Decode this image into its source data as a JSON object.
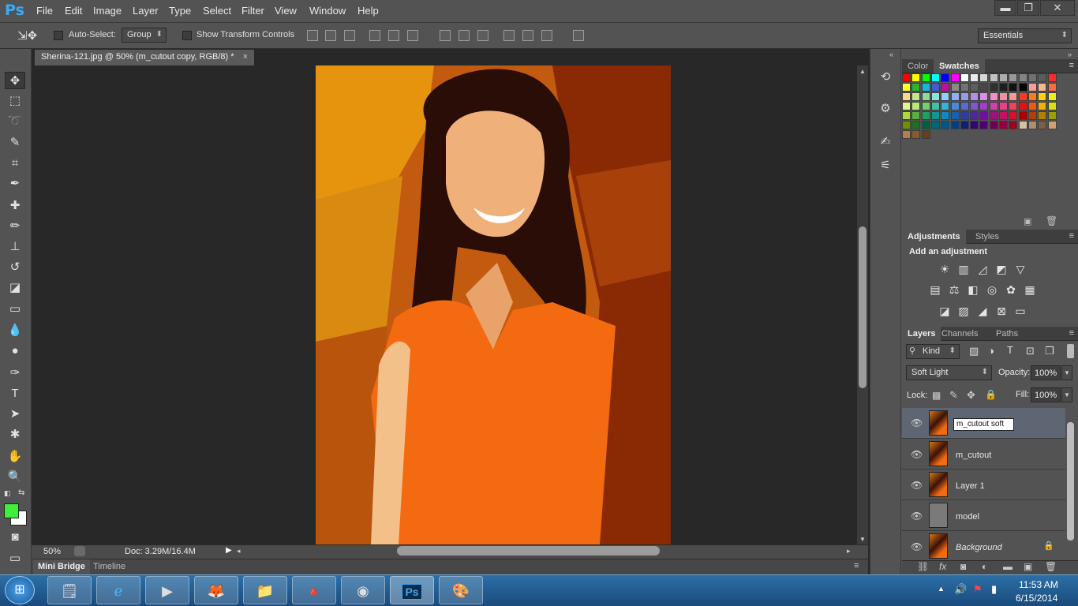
{
  "app": {
    "logo": "Ps"
  },
  "menu": [
    "File",
    "Edit",
    "Image",
    "Layer",
    "Type",
    "Select",
    "Filter",
    "View",
    "Window",
    "Help"
  ],
  "window_buttons": {
    "minimize": "▬",
    "maximize": "❐",
    "close": "✕"
  },
  "options": {
    "auto_select_label": "Auto-Select:",
    "auto_select_value": "Group",
    "show_transform_label": "Show Transform Controls",
    "workspace": "Essentials"
  },
  "document": {
    "tab_title": "Sherina-121.jpg @ 50% (m_cutout copy, RGB/8) *",
    "close": "×"
  },
  "status": {
    "zoom": "50%",
    "doc_size": "Doc: 3.29M/16.4M"
  },
  "bottom_tabs": [
    "Mini Bridge",
    "Timeline"
  ],
  "panels": {
    "color_tab": "Color",
    "swatches_tab": "Swatches",
    "adjustments_tab": "Adjustments",
    "styles_tab": "Styles",
    "add_adjustment": "Add an adjustment",
    "layers_tab": "Layers",
    "channels_tab": "Channels",
    "paths_tab": "Paths",
    "kind_label": "Kind",
    "blend_mode": "Soft Light",
    "opacity_label": "Opacity:",
    "opacity_value": "100%",
    "lock_label": "Lock:",
    "fill_label": "Fill:",
    "fill_value": "100%"
  },
  "layers": [
    {
      "name": "m_cutout soft",
      "editing": true
    },
    {
      "name": "m_cutout"
    },
    {
      "name": "Layer 1"
    },
    {
      "name": "model"
    },
    {
      "name": "Background",
      "italic": true,
      "locked": true
    }
  ],
  "taskbar": {
    "time": "11:53 AM",
    "date": "6/15/2014"
  },
  "swatch_colors": [
    [
      "#ff0000",
      "#ffff00",
      "#00ff00",
      "#00ffff",
      "#0000ff",
      "#ff00ff",
      "#ffffff",
      "#ebebeb",
      "#d6d6d6",
      "#c2c2c2",
      "#adadad",
      "#999999",
      "#858585",
      "#707070",
      "#5c5c5c",
      "#ff2a2a"
    ],
    [
      "#ffff33",
      "#2ab52a",
      "#1ab8d0",
      "#3c5ed0",
      "#c0109a",
      "#8a8a8a",
      "#747474",
      "#5e5e5e",
      "#474747",
      "#303030",
      "#1e1e1e",
      "#111111",
      "#000000",
      "#f7a08f",
      "#f7b88f",
      "#ff6a3a"
    ],
    [
      "#f7d88f",
      "#c6e38f",
      "#8fd8a0",
      "#8fe0d8",
      "#8fd0f7",
      "#8fb0f0",
      "#9a9ae8",
      "#b18fe8",
      "#d88fe8",
      "#f08fc8",
      "#f08fa8",
      "#f79a8f",
      "#ff3a1a",
      "#ff7a1a",
      "#ffd01a",
      "#e8f01a"
    ],
    [
      "#e0f58f",
      "#b8e878",
      "#70d070",
      "#40c0a0",
      "#3ab0d8",
      "#4a88d8",
      "#5a6ad0",
      "#7a5ad0",
      "#a040c8",
      "#d040a8",
      "#e8408a",
      "#f0405a",
      "#e81010",
      "#f05a10",
      "#f0b010",
      "#d8e010"
    ],
    [
      "#b0d83a",
      "#58b03a",
      "#20a060",
      "#109890",
      "#1088c0",
      "#1860b0",
      "#2a3ea8",
      "#4a2aa0",
      "#7010a0",
      "#a01080",
      "#c81060",
      "#d81030",
      "#a80000",
      "#b04000",
      "#b08000",
      "#98a000"
    ],
    [
      "#709000",
      "#207020",
      "#006040",
      "#006870",
      "#005888",
      "#083e80",
      "#101e78",
      "#2e0870",
      "#500070",
      "#700058",
      "#900040",
      "#a00020",
      "#d8c0a0",
      "#a89070",
      "#786048",
      "#d0a070"
    ],
    [
      "#b0804a",
      "#8a5a2a",
      "#6a3e18"
    ]
  ]
}
